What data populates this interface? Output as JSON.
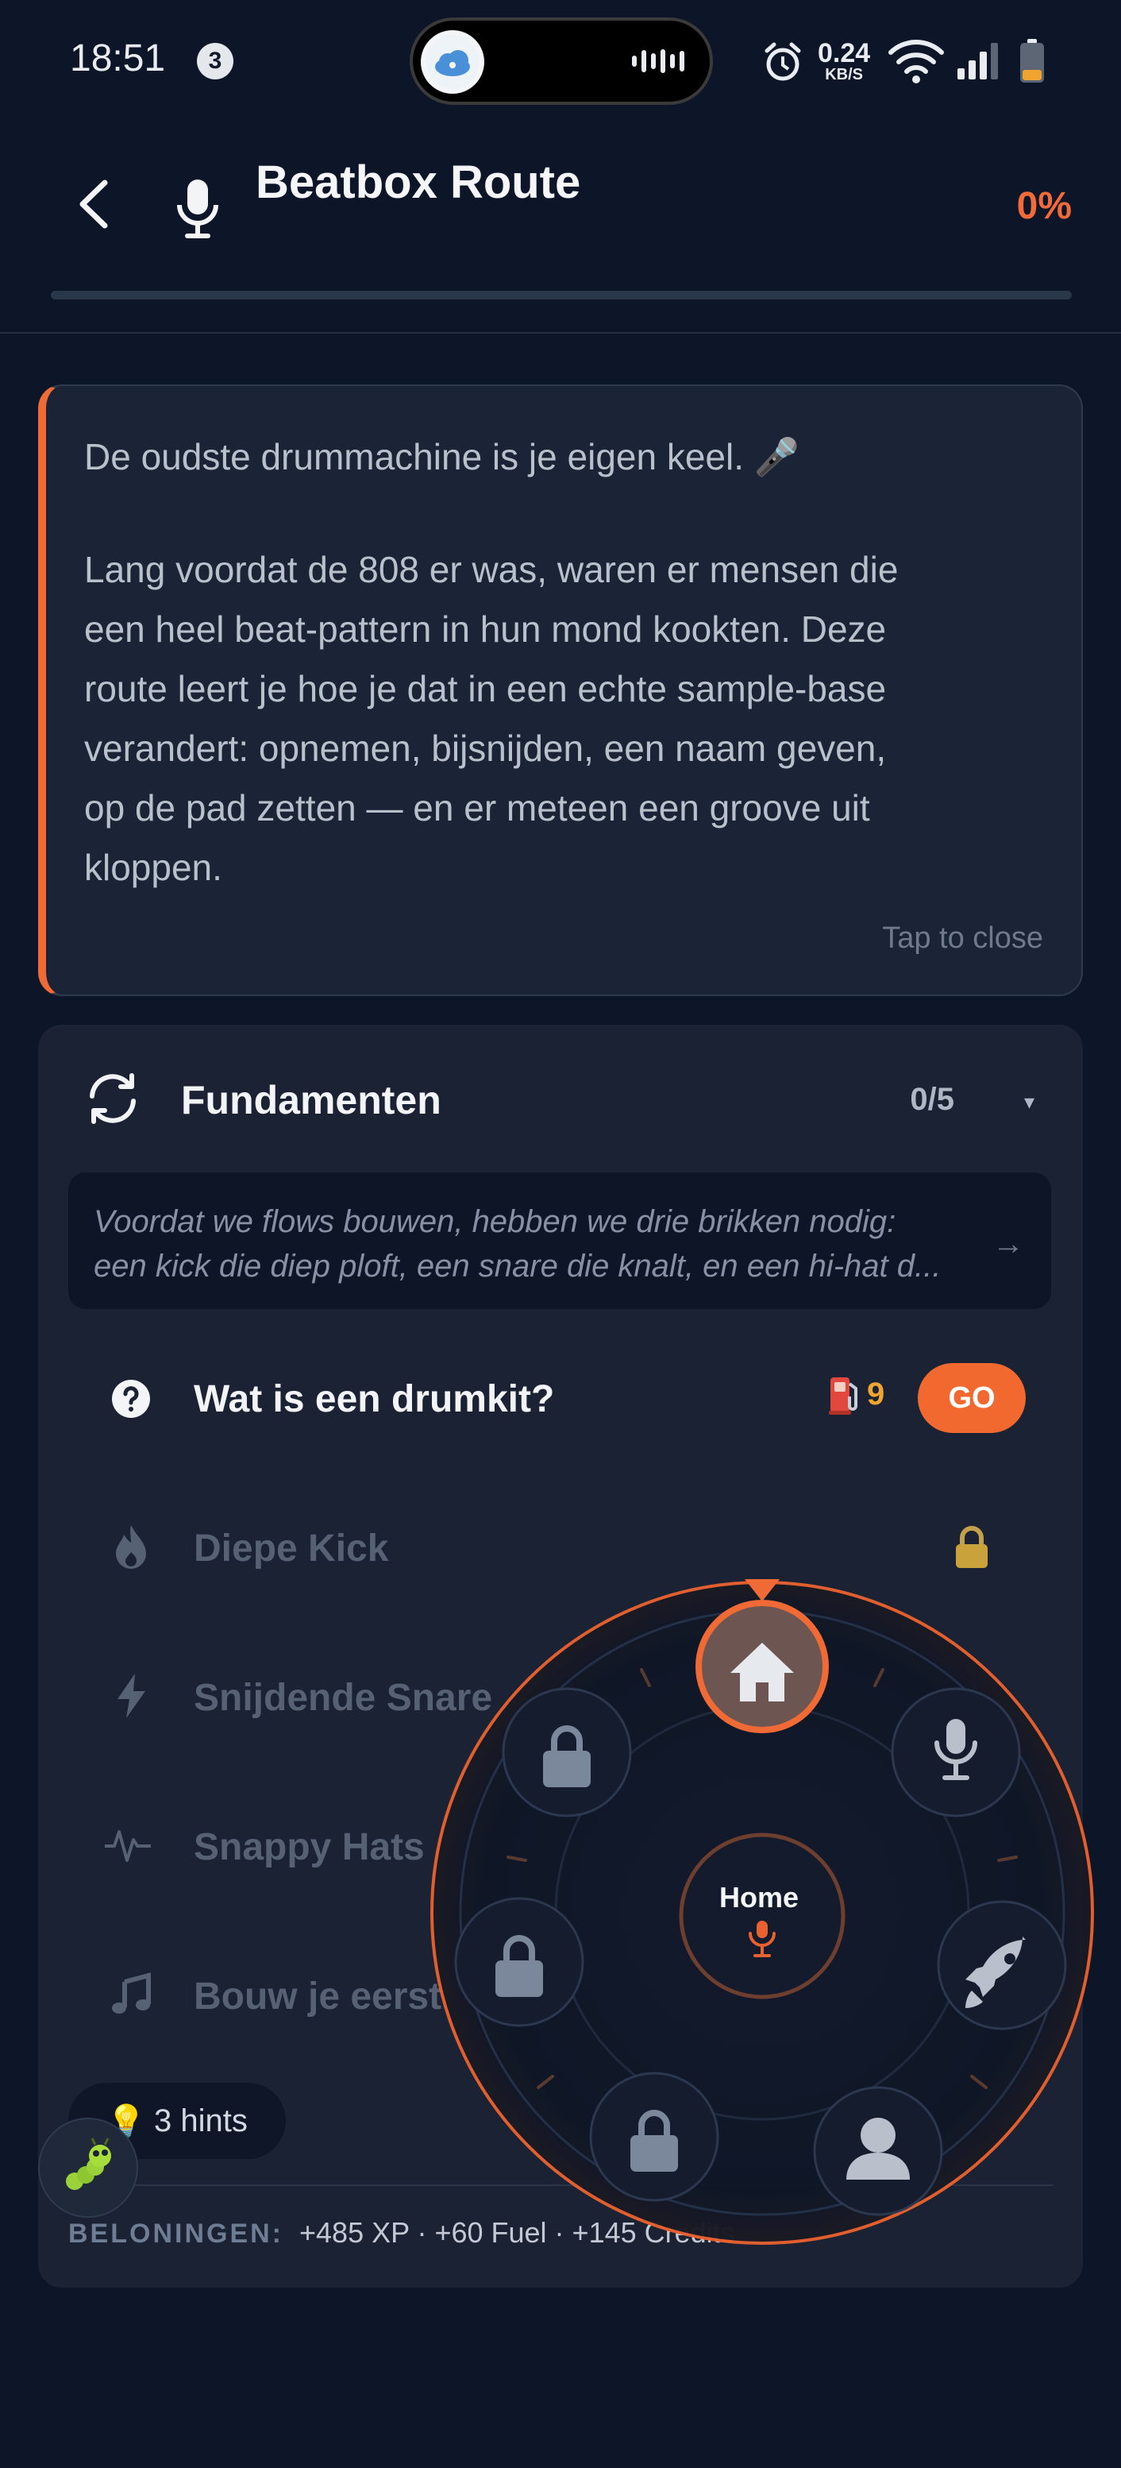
{
  "status_bar": {
    "time": "18:51",
    "notification_count": "3",
    "net_speed": "0.24",
    "net_unit": "KB/S",
    "icons": [
      "alarm-icon",
      "wifi-icon",
      "signal-icon",
      "battery-icon"
    ]
  },
  "header": {
    "title": "Beatbox Route",
    "progress_text": "0%",
    "progress_value": 0,
    "accent_color": "#f26a3a"
  },
  "intro_card": {
    "first_line": "De oudste drummachine is je eigen keel. 🎤",
    "paragraph_lines": [
      "Lang voordat de 808 er was, waren er mensen die",
      "een heel beat-pattern in hun mond kookten. Deze",
      "route leert je hoe je dat in een echte sample-base",
      "verandert: opnemen, bijsnijden, een naam geven,",
      "op de pad zetten — en er meteen een groove uit",
      "kloppen."
    ],
    "close_hint": "Tap to close"
  },
  "section": {
    "title": "Fundamenten",
    "count": "0/5",
    "caret": "▾",
    "intro_lines": [
      "Voordat we flows bouwen, hebben we drie brikken nodig:",
      "een kick die diep ploft, een snare die knalt, en een hi-hat d..."
    ],
    "intro_arrow": "→",
    "lessons": [
      {
        "label": "Wat is een drumkit?",
        "icon": "question-icon",
        "state": "active",
        "fuel": "9",
        "action": "GO"
      },
      {
        "label": "Diepe Kick",
        "icon": "flame-icon",
        "state": "locked"
      },
      {
        "label": "Snijdende Snare",
        "icon": "lightning-icon",
        "state": "locked"
      },
      {
        "label": "Snappy Hats",
        "icon": "waveform-icon",
        "state": "locked"
      },
      {
        "label": "Bouw je eerst",
        "icon": "music-note-icon",
        "state": "locked"
      }
    ],
    "rewards_label": "BELONINGEN:",
    "rewards_text": "+485 XP · +60 Fuel · +145 Credits"
  },
  "hints": {
    "icon": "💡",
    "label": "3 hints"
  },
  "radial_menu": {
    "center_label": "Home",
    "nodes": [
      "home-icon",
      "microphone-icon",
      "rocket-icon",
      "person-icon",
      "lock-icon",
      "lock-icon",
      "lock-icon"
    ]
  }
}
